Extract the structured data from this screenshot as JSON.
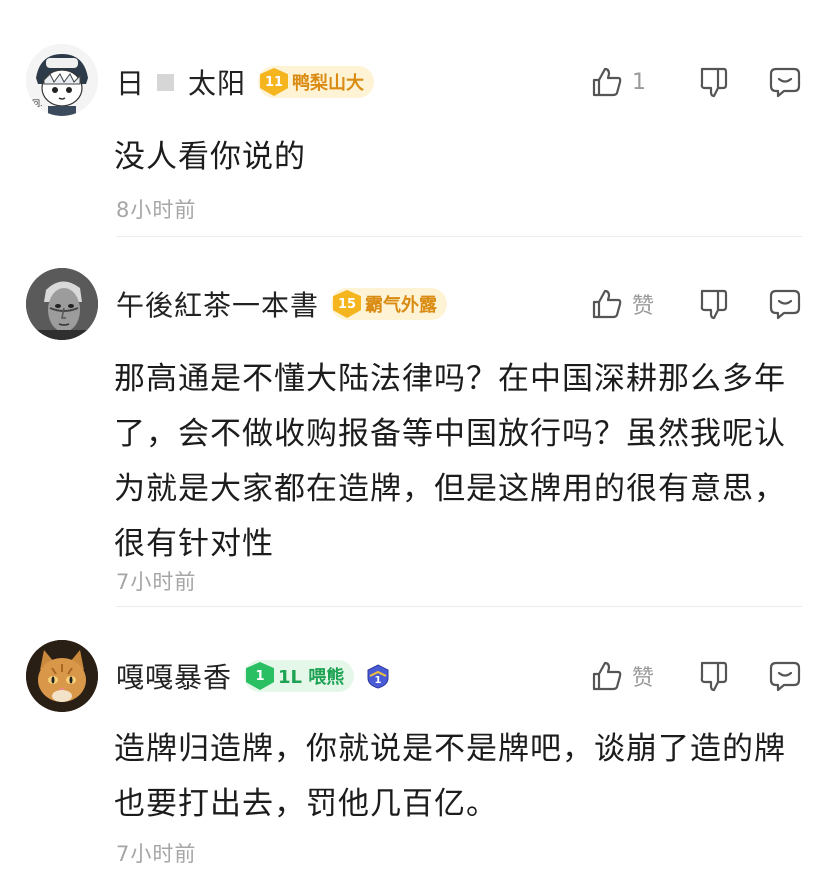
{
  "comments": [
    {
      "username_prefix": "日",
      "username_suffix": "太阳",
      "badge": {
        "level": "11",
        "title": "鸭梨山大",
        "style": "gold"
      },
      "like": {
        "count": "1"
      },
      "text": "没人看你说的",
      "time": "8小时前"
    },
    {
      "username": "午後紅茶一本書",
      "badge": {
        "level": "15",
        "title": "霸气外露",
        "style": "gold"
      },
      "like": {
        "label": "赞"
      },
      "text": "那高通是不懂大陆法律吗？在中国深耕那么多年了，会不做收购报备等中国放行吗？虽然我呢认为就是大家都在造牌，但是这牌用的很有意思，很有针对性",
      "time": "7小时前"
    },
    {
      "username": "嘎嘎暴香",
      "badge": {
        "level": "1",
        "title": "1L 喂熊",
        "style": "green"
      },
      "like": {
        "label": "赞"
      },
      "text": "造牌归造牌，你就说是不是牌吧，谈崩了造的牌也要打出去，罚他几百亿。",
      "time": "7小时前"
    }
  ],
  "icons": {
    "like": "thumbs-up-icon",
    "dislike": "thumbs-down-icon",
    "reply": "comment-bubble-icon",
    "rank": "rank-shield-icon"
  },
  "colors": {
    "gold_badge": "#f5b51e",
    "gold_text": "#d98b12",
    "green_badge": "#2bbf63",
    "meta_gray": "#a6a6a6"
  }
}
